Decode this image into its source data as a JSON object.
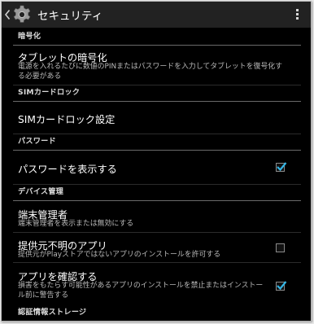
{
  "header": {
    "title": "セキュリティ",
    "app_icon": "gear-icon",
    "nav_icon": "chevron-left-icon",
    "menu_icon": "overflow-menu-icon"
  },
  "sections": {
    "encryption": {
      "header": "暗号化",
      "encrypt_tablet": {
        "title": "タブレットの暗号化",
        "summary": "電源を入れるたびに数値のPINまたはパスワードを入力してタブレットを復号化する必要がある"
      }
    },
    "sim_lock": {
      "header": "SIMカードロック",
      "sim_lock_settings": {
        "title": "SIMカードロック設定"
      }
    },
    "password": {
      "header": "パスワード",
      "show_password": {
        "title": "パスワードを表示する",
        "checked": true
      }
    },
    "device_admin": {
      "header": "デバイス管理",
      "device_administrators": {
        "title": "端末管理者",
        "summary": "端末管理者を表示または無効にする"
      },
      "unknown_sources": {
        "title": "提供元不明のアプリ",
        "summary": "提供元がPlayストアではないアプリのインストールを許可する",
        "checked": false
      },
      "verify_apps": {
        "title": "アプリを確認する",
        "summary": "損害をもたらす可能性があるアプリのインストールを禁止またはインストール前に警告する",
        "checked": true
      }
    },
    "credential_storage": {
      "header": "認証情報ストレージ"
    }
  },
  "colors": {
    "accent": "#33b5e5",
    "background": "#000000",
    "actionbar": "#222222",
    "divider": "#6a6a6a",
    "summary_text": "#b9b9b9"
  }
}
